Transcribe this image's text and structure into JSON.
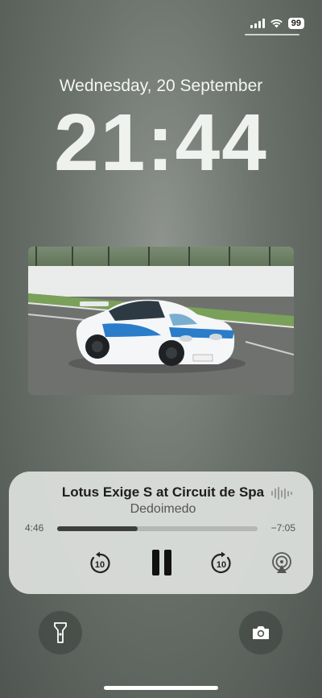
{
  "status_bar": {
    "battery": "99",
    "icons": [
      "signal-icon",
      "wifi-icon",
      "battery-icon"
    ]
  },
  "lockscreen": {
    "date": "Wednesday, 20 September",
    "time": "21:44"
  },
  "photo": {
    "icon": "race-car-photo"
  },
  "now_playing": {
    "title": "Lotus Exige S at Circuit de Spa",
    "artist": "Dedoimedo",
    "elapsed": "4:46",
    "remaining": "−7:05",
    "progress": 0.4,
    "skip_back_label": "10",
    "skip_forward_label": "10",
    "icons": [
      "waveform-icon",
      "skip-back-10-icon",
      "pause-icon",
      "skip-forward-10-icon",
      "airplay-icon"
    ]
  },
  "quick_actions": {
    "icons": [
      "flashlight-icon",
      "camera-icon"
    ]
  },
  "colors": {
    "player_bg": "#dee2de",
    "wallpaper": "#6b716b",
    "car_blue": "#2b7cc9"
  }
}
